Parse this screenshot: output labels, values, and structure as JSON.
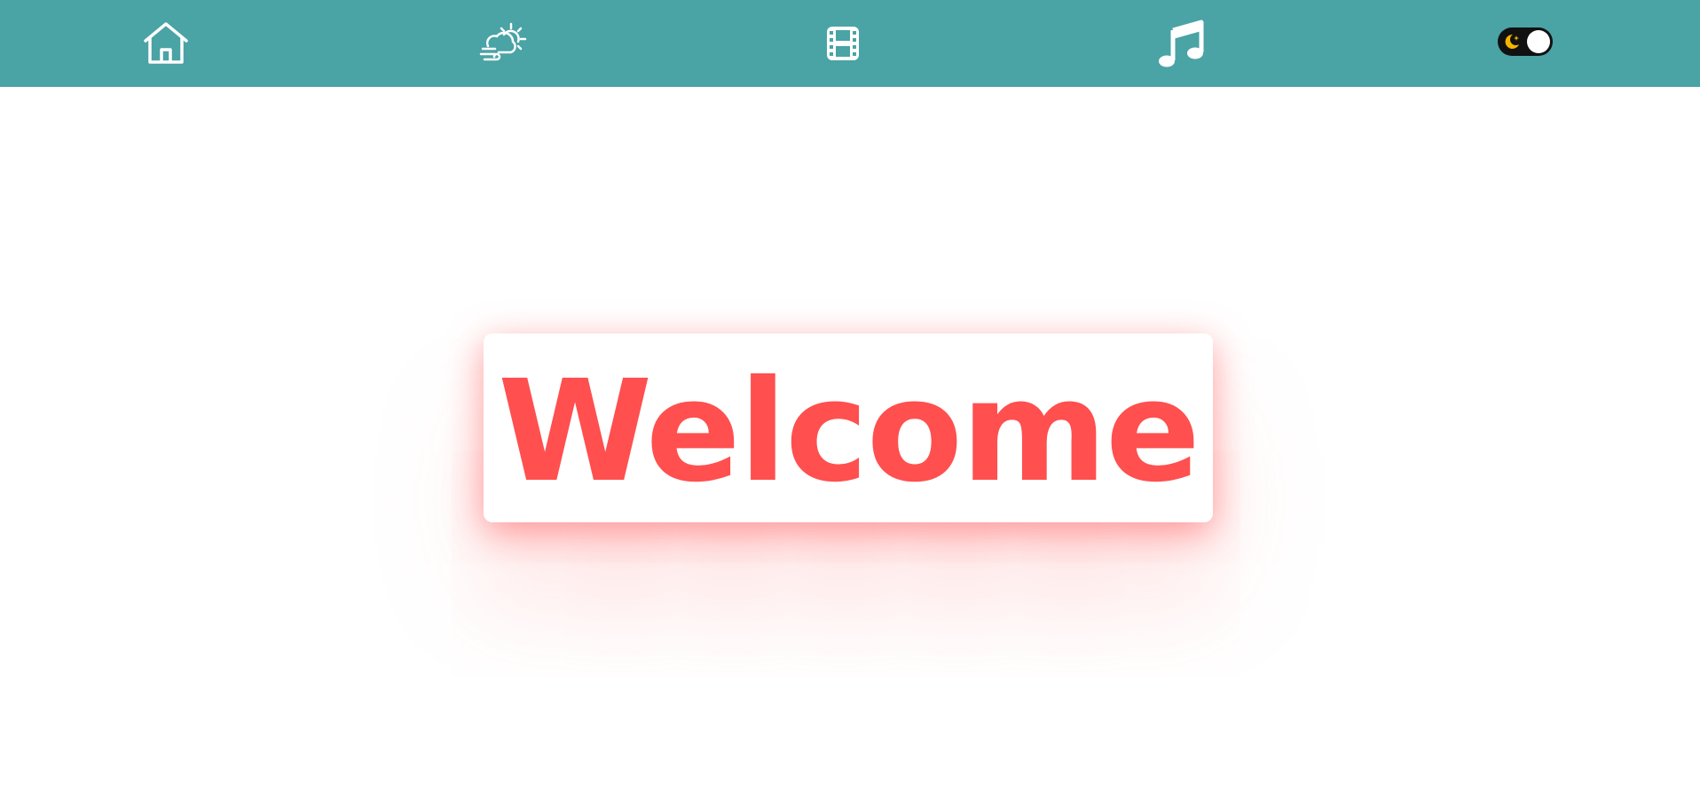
{
  "navbar": {
    "background": "#4aa3a5",
    "items": [
      {
        "icon": "home-icon"
      },
      {
        "icon": "weather-icon"
      },
      {
        "icon": "film-icon"
      },
      {
        "icon": "music-note-icon"
      }
    ],
    "theme_toggle": {
      "icon": "moon-icon",
      "accent": "#f5b400"
    }
  },
  "main": {
    "welcome_text": "Welcome",
    "accent": "#ff4f4f"
  }
}
